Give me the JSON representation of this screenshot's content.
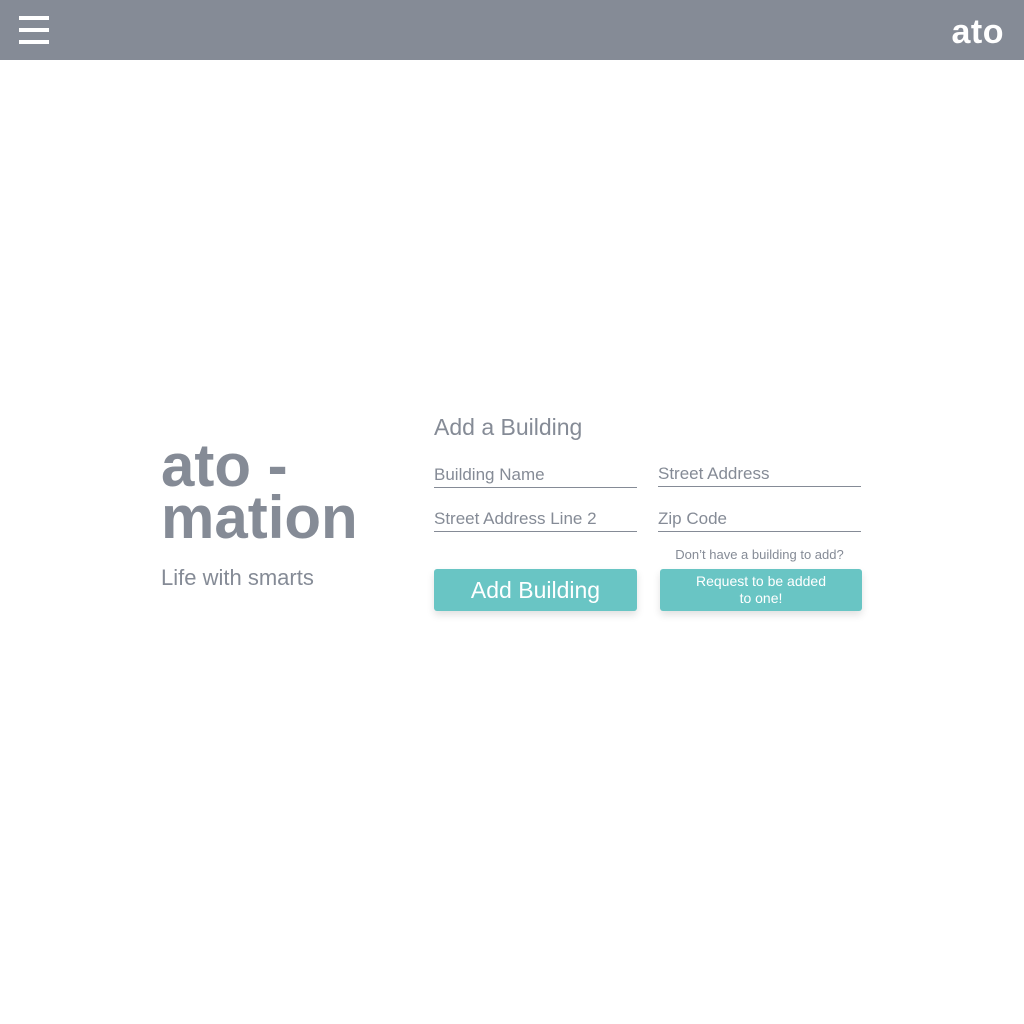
{
  "header": {
    "logo": "ato",
    "menu_icon": "hamburger-icon"
  },
  "brand": {
    "title_line1": "ato -",
    "title_line2": "mation",
    "tagline": "Life with smarts"
  },
  "form": {
    "title": "Add a Building",
    "fields": {
      "building_name": {
        "placeholder": "Building Name",
        "value": ""
      },
      "street_address": {
        "placeholder": "Street Address",
        "value": ""
      },
      "street_address_2": {
        "placeholder": "Street Address Line 2",
        "value": ""
      },
      "zip_code": {
        "placeholder": "Zip Code",
        "value": ""
      }
    },
    "hint": "Don’t have a building to add?",
    "add_button_label": "Add Building",
    "request_button_label": "Request to be added to one!"
  },
  "colors": {
    "header_bg": "#858b96",
    "text_gray": "#858b96",
    "accent_teal": "#69c5c4",
    "button_text": "#ffffff"
  }
}
